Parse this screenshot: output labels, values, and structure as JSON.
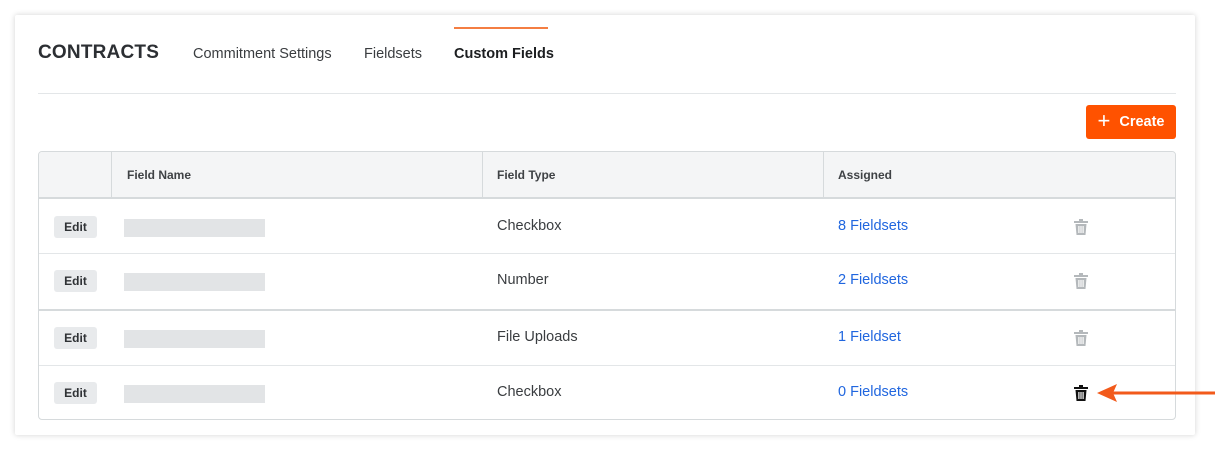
{
  "header": {
    "title": "CONTRACTS",
    "tabs": [
      {
        "label": "Commitment Settings"
      },
      {
        "label": "Fieldsets"
      },
      {
        "label": "Custom Fields"
      }
    ]
  },
  "toolbar": {
    "create_label": "Create"
  },
  "table": {
    "columns": [
      "Field Name",
      "Field Type",
      "Assigned"
    ],
    "rows": [
      {
        "edit_label": "Edit",
        "type": "Checkbox",
        "assigned": "8 Fieldsets"
      },
      {
        "edit_label": "Edit",
        "type": "Number",
        "assigned": "2 Fieldsets"
      },
      {
        "edit_label": "Edit",
        "type": "File Uploads",
        "assigned": "1 Fieldset"
      },
      {
        "edit_label": "Edit",
        "type": "Checkbox",
        "assigned": "0 Fieldsets"
      }
    ]
  },
  "colors": {
    "accent": "#ff5200",
    "link": "#2066df",
    "trash_disabled": "#b4b8bb",
    "trash_enabled": "#111111"
  },
  "icons": [
    "plus-icon",
    "trash-icon",
    "arrow-icon"
  ]
}
